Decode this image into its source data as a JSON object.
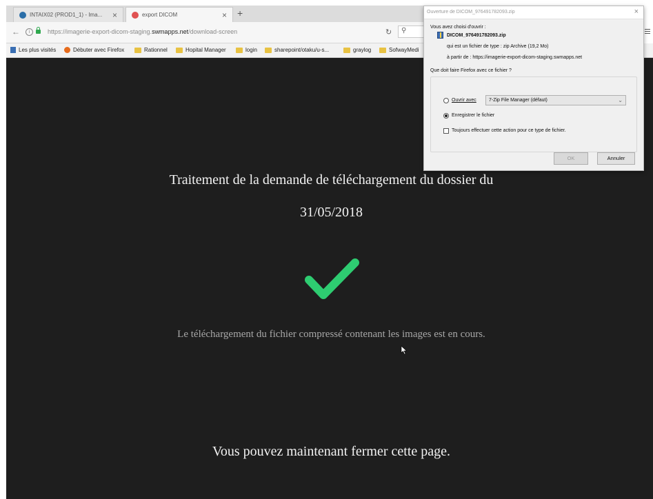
{
  "browser": {
    "tabs": [
      {
        "label": "INTAIX02 (PROD1_1) - Ima..."
      },
      {
        "label": "export DICOM"
      }
    ],
    "new_tab_symbol": "+",
    "url_prefix": "https://imagerie-export-dicom-staging.",
    "url_domain": "swmapps.net",
    "url_path": "/download-screen",
    "bookmarks": [
      {
        "label": "Les plus visités",
        "icon": "doc-icon"
      },
      {
        "label": "Débuter avec Firefox",
        "icon": "firefox-icon"
      },
      {
        "label": "Rationnel",
        "icon": "folder-icon"
      },
      {
        "label": "Hopital Manager",
        "icon": "folder-icon"
      },
      {
        "label": "login",
        "icon": "folder-icon"
      },
      {
        "label": "sharepoint/otaku/u-s...",
        "icon": "folder-icon"
      },
      {
        "label": "graylog",
        "icon": "folder-icon"
      },
      {
        "label": "SofwayMedi",
        "icon": "folder-icon"
      }
    ]
  },
  "page": {
    "heading": "Traitement de la demande de téléchargement du dossier du",
    "date": "31/05/2018",
    "status": "Le téléchargement du fichier compressé contenant les images est en cours.",
    "closing": "Vous pouvez maintenant fermer cette page.",
    "check_color": "#2ecc71",
    "background_color": "#1e1e1e"
  },
  "dialog": {
    "title": "Ouverture de DICOM_976491782093.zip",
    "chosen_label": "Vous avez choisi d'ouvrir :",
    "file_name": "DICOM_976491782093.zip",
    "file_type_line": "qui est un fichier de type : zip Archive (19,2 Mo)",
    "source_line": "à partir de : https://imagerie-export-dicom-staging.swmapps.net",
    "question": "Que doit faire Firefox avec ce fichier ?",
    "open_with_label": "Ouvrir avec",
    "open_with_app": "7-Zip File Manager (défaut)",
    "save_label": "Enregistrer le fichier",
    "save_selected": true,
    "always_label": "Toujours effectuer cette action pour ce type de fichier.",
    "ok_label": "OK",
    "cancel_label": "Annuler"
  }
}
